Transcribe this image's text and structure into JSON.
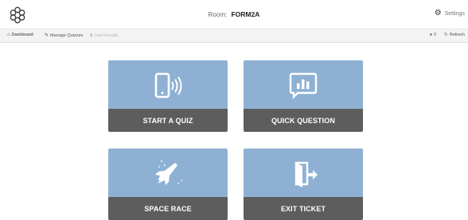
{
  "header": {
    "room_prefix": "Room:",
    "room_name": "FORM2A",
    "settings_label": "Settings"
  },
  "nav": {
    "tabs": [
      {
        "label": "Dashboard",
        "icon": "home-icon",
        "state": "active"
      },
      {
        "label": "Manage Quizzes",
        "icon": "wrench-icon",
        "state": "normal"
      },
      {
        "label": "Live Results",
        "icon": "bar-chart-icon",
        "state": "disabled"
      }
    ],
    "student_count": "0",
    "refresh_label": "Refresh"
  },
  "tiles": [
    {
      "label": "START A QUIZ",
      "icon": "phone-signal-icon"
    },
    {
      "label": "QUICK QUESTION",
      "icon": "speech-bubble-chart-icon"
    },
    {
      "label": "SPACE RACE",
      "icon": "rocket-icon"
    },
    {
      "label": "EXIT TICKET",
      "icon": "exit-door-icon"
    }
  ],
  "colors": {
    "tile_top": "#8eb1d3",
    "tile_label": "#5d5d5d"
  }
}
